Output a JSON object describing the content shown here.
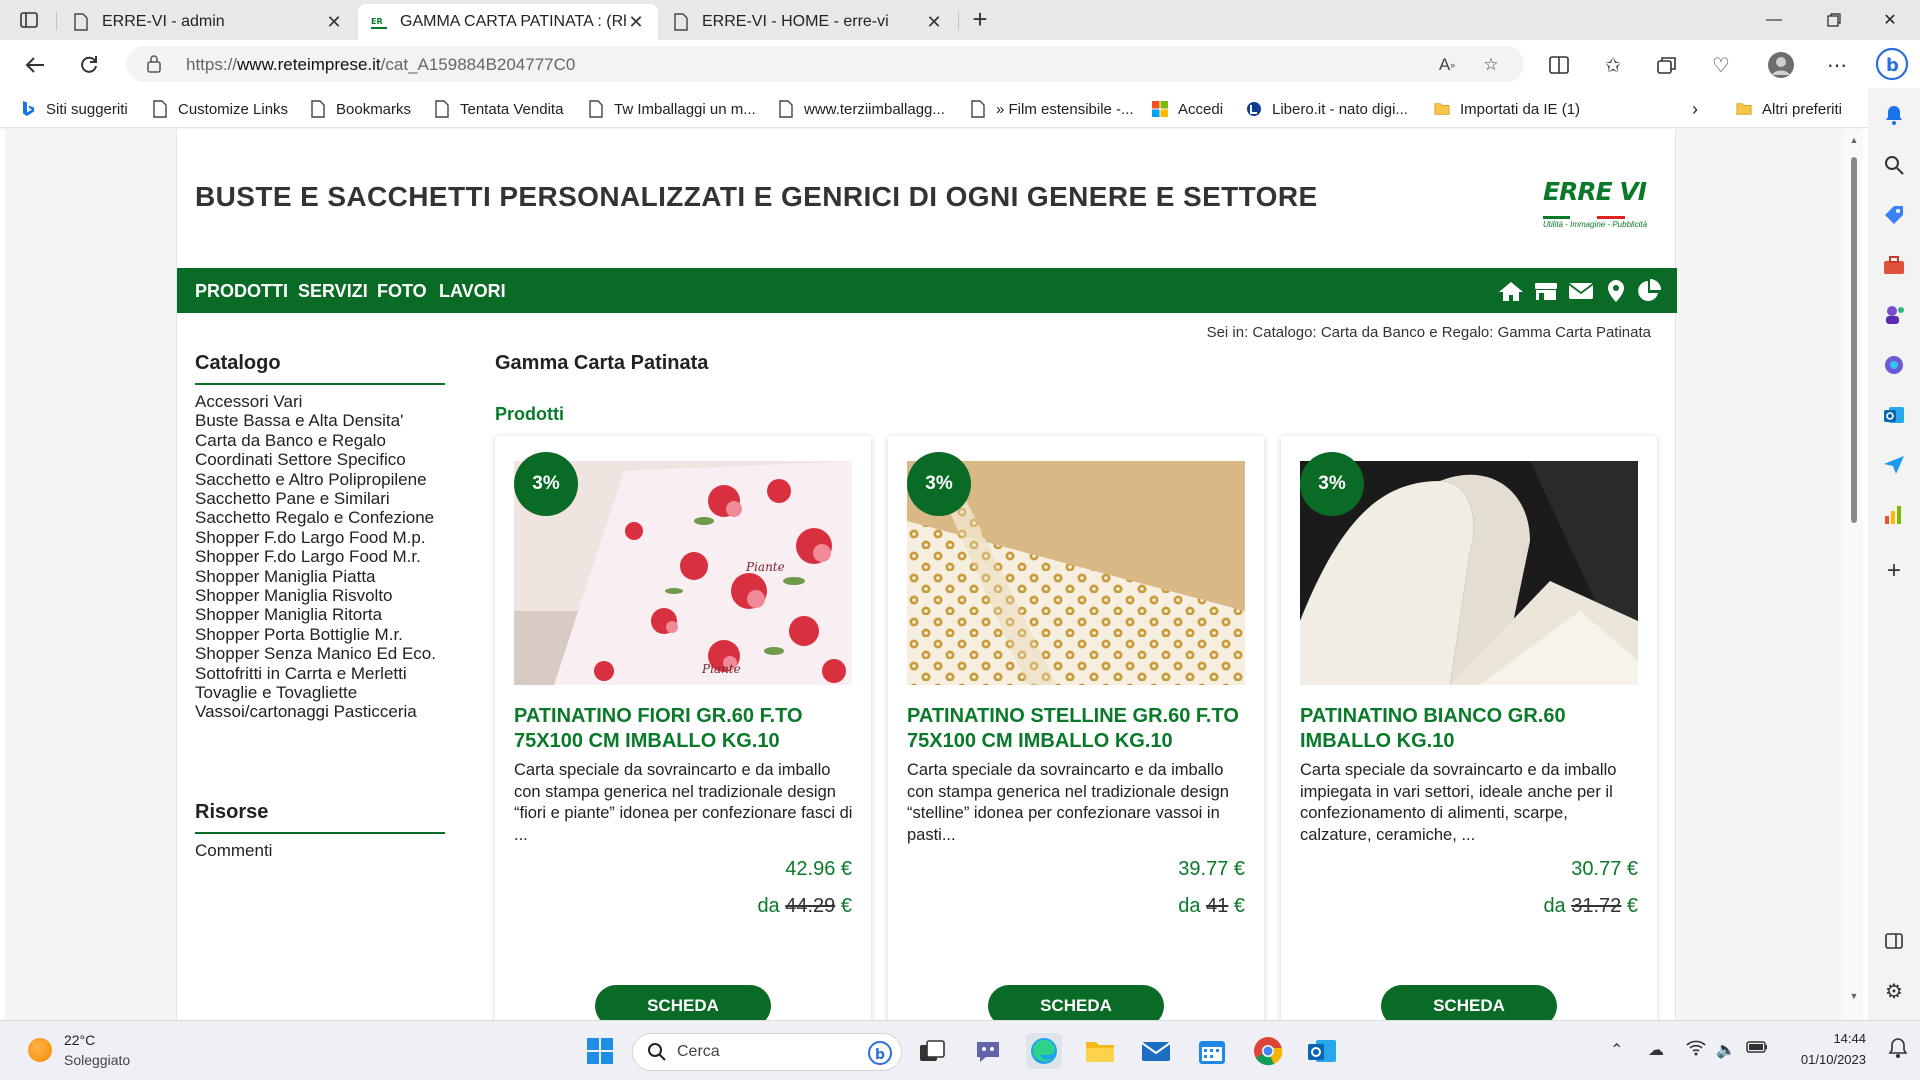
{
  "browser": {
    "tabs": [
      {
        "title": "ERRE-VI - admin",
        "active": false
      },
      {
        "title": "GAMMA CARTA PATINATA : (Rho",
        "active": true
      },
      {
        "title": "ERRE-VI - HOME - erre-vi",
        "active": false
      }
    ],
    "new_tab": "+",
    "url_prefix": "https://",
    "url_host": "www.reteimprese.it",
    "url_path": "/cat_A159884B204777C0",
    "favorites": [
      {
        "label": "Siti suggeriti",
        "icon": "bing-icon"
      },
      {
        "label": "Customize Links",
        "icon": "page-icon"
      },
      {
        "label": "Bookmarks",
        "icon": "page-icon"
      },
      {
        "label": "Tentata Vendita",
        "icon": "page-icon"
      },
      {
        "label": "Tw Imballaggi un m...",
        "icon": "page-icon"
      },
      {
        "label": "www.terziimballagg...",
        "icon": "page-icon"
      },
      {
        "label": "» Film estensibile -...",
        "icon": "page-icon"
      },
      {
        "label": "Accedi",
        "icon": "microsoft-icon"
      },
      {
        "label": "Libero.it - nato digi...",
        "icon": "libero-icon"
      },
      {
        "label": "Importati da IE (1)",
        "icon": "folder-icon"
      }
    ],
    "other_favorites": "Altri preferiti"
  },
  "site": {
    "header_title": "BUSTE E SACCHETTI PERSONALIZZATI E GENRICI DI OGNI GENERE E SETTORE",
    "logo_text": "ERRE VI",
    "logo_tagline": "Utilità - Immagine - Pubblicità",
    "nav": [
      "PRODOTTI",
      "SERVIZI",
      "FOTO",
      "LAVORI"
    ],
    "breadcrumb": "Sei in: Catalogo: Carta da Banco e Regalo: Gamma Carta Patinata",
    "catalog_title": "Catalogo",
    "catalog_items": [
      "Accessori Vari",
      "Buste Bassa e Alta Densita'",
      "Carta da Banco e Regalo",
      "Coordinati Settore Specifico",
      "Sacchetto e Altro Polipropilene",
      "Sacchetto Pane e Similari",
      "Sacchetto Regalo e Confezione",
      "Shopper F.do Largo Food M.p.",
      "Shopper F.do Largo Food M.r.",
      "Shopper Maniglia Piatta",
      "Shopper Maniglia Risvolto",
      "Shopper Maniglia Ritorta",
      "Shopper Porta Bottiglie M.r.",
      "Shopper Senza Manico Ed Eco.",
      "Sottofritti in Carrta e Merletti",
      "Tovaglie e Tovagliette",
      "Vassoi/cartonaggi Pasticceria"
    ],
    "resources_title": "Risorse",
    "resources_items": [
      "Commenti"
    ],
    "content_title": "Gamma Carta Patinata",
    "products_label": "Prodotti",
    "products": [
      {
        "badge": "3%",
        "name": "PATINATINO FIORI GR.60 F.TO 75X100 CM IMBALLO KG.10",
        "desc": "Carta speciale da sovraincarto e da imballo con stampa generica nel tradizionale design “fiori e piante” idonea per confezionare fasci di ...",
        "price": "42.96 €",
        "from_label": "da",
        "old_price": "44.29",
        "currency": "€",
        "button": "SCHEDA"
      },
      {
        "badge": "3%",
        "name": "PATINATINO STELLINE GR.60 F.TO 75X100 CM IMBALLO KG.10",
        "desc": "Carta speciale da sovraincarto e da imballo con stampa generica nel tradizionale design “stelline” idonea per confezionare vassoi in pasti...",
        "price": "39.77 €",
        "from_label": "da",
        "old_price": "41",
        "currency": "€",
        "button": "SCHEDA"
      },
      {
        "badge": "3%",
        "name": "PATINATINO BIANCO GR.60 IMBALLO KG.10",
        "desc": "Carta speciale da sovraincarto e da imballo impiegata in vari settori, ideale anche per il confezionamento di alimenti, scarpe, calzature, ceramiche, ...",
        "price": "30.77 €",
        "from_label": "da",
        "old_price": "31.72",
        "currency": "€",
        "button": "SCHEDA"
      }
    ]
  },
  "taskbar": {
    "temperature": "22°C",
    "weather": "Soleggiato",
    "search_placeholder": "Cerca",
    "time": "14:44",
    "date": "01/10/2023"
  },
  "colors": {
    "brand_green": "#0a6b26",
    "link_green": "#0a7a2a"
  }
}
